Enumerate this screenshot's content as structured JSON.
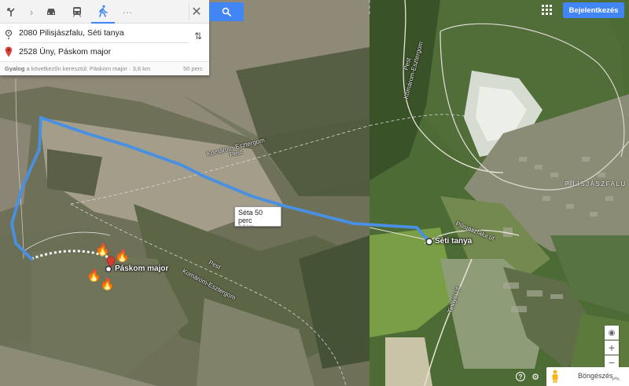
{
  "modes": {
    "directions_icon": "directions-icon",
    "car_icon": "car-icon",
    "transit_icon": "transit-icon",
    "walk_icon": "walk-icon",
    "more_icon": "more-icon",
    "close_icon": "close-icon",
    "active": "walk",
    "more_label": "···"
  },
  "route": {
    "origin": "2080 Pilisjászfalu, Séti tanya",
    "destination": "2528 Úny, Páskom major",
    "summary_mode": "Gyalog",
    "summary_text": "a következőn keresztül: Páskom major · 3,8 km",
    "duration": "50 perc"
  },
  "top_right": {
    "signin_label": "Bejelentkezés"
  },
  "map": {
    "bubble_title": "Séta  50 perc",
    "bubble_sub": "3,8 km",
    "road_label_1": "Komárom-Esztergom",
    "road_label_1b": "Pest",
    "road_label_2": "Komárom-Esztergom",
    "road_label_2b": "Pest",
    "road_label_3": "Komárom-Esztergom",
    "road_label_3b": "Pest",
    "road_label_4": "Pilisjászfalui út",
    "road_label_5": "Tinnyei út",
    "origin_label": "Séti tanya",
    "destination_label": "Páskom major",
    "town_label": "PILISJÁSZFALU",
    "route_color": "#4a90e2"
  },
  "bottom": {
    "browse_label": "Böngészés",
    "help_icon": "?",
    "settings_icon": "⚙"
  }
}
